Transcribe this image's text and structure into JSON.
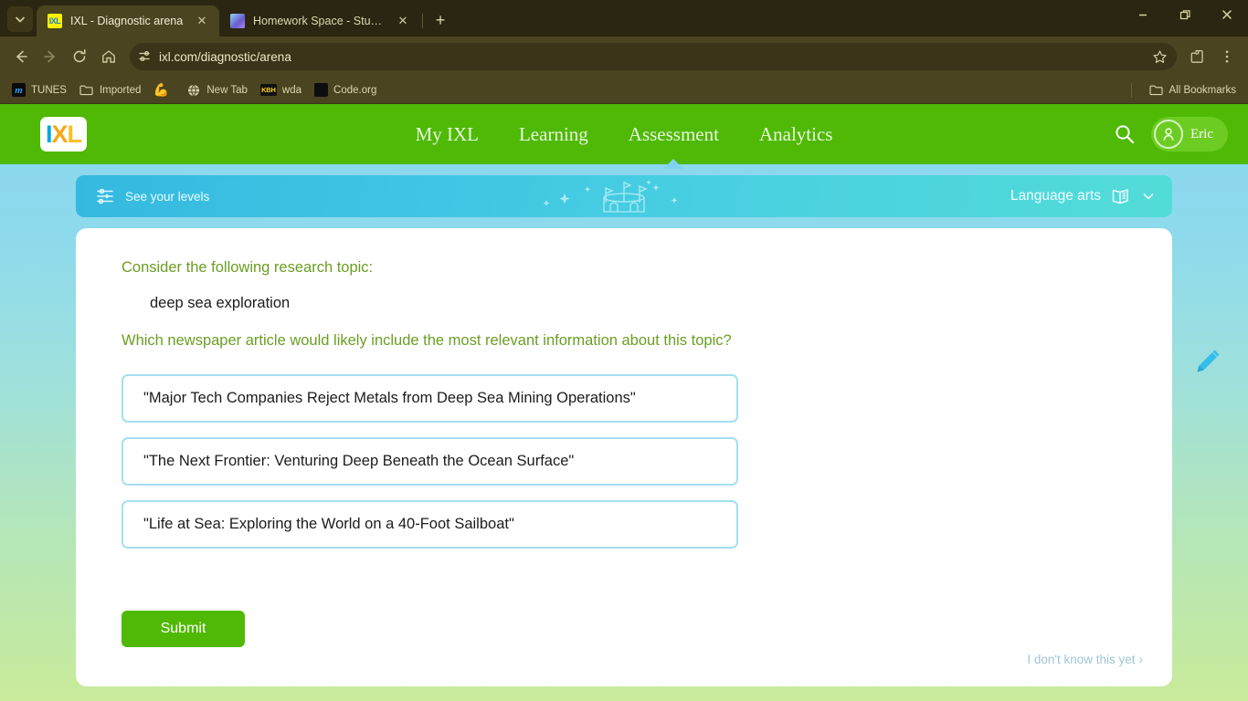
{
  "browser": {
    "tabs": [
      {
        "title": "IXL - Diagnostic arena",
        "favicon": "ixl-favicon",
        "active": true,
        "close_label": "✕"
      },
      {
        "title": "Homework Space - StudyX",
        "favicon": "studyx-favicon",
        "active": false,
        "close_label": "✕"
      }
    ],
    "new_tab_label": "+",
    "tab_list_icon": "chevron-down-icon",
    "window_controls": {
      "minimize": "—",
      "maximize": "❐",
      "close": "✕"
    },
    "toolbar": {
      "back_icon": "back-arrow-icon",
      "forward_icon": "forward-arrow-icon",
      "reload_icon": "reload-icon",
      "home_icon": "home-icon",
      "site_info_icon": "page-settings-icon",
      "url": "ixl.com/diagnostic/arena",
      "bookmark_star_icon": "star-icon",
      "extensions_icon": "extensions-puzzle-icon",
      "menu_icon": "three-dot-menu-icon"
    },
    "bookmarks": [
      {
        "label": "TUNES",
        "icon": "m-favicon"
      },
      {
        "label": "Imported",
        "icon": "folder-icon"
      },
      {
        "label": "",
        "icon": "flexed-biceps-emoji"
      },
      {
        "label": "New Tab",
        "icon": "globe-icon"
      },
      {
        "label": "wda",
        "icon": "kbh-favicon"
      },
      {
        "label": "Code.org",
        "icon": "code-grid-icon"
      }
    ],
    "all_bookmarks_label": "All Bookmarks"
  },
  "site": {
    "logo": {
      "i": "I",
      "x": "X",
      "l": "L"
    },
    "nav": [
      {
        "label": "My IXL",
        "active": false
      },
      {
        "label": "Learning",
        "active": false
      },
      {
        "label": "Assessment",
        "active": true
      },
      {
        "label": "Analytics",
        "active": false
      }
    ],
    "search_icon": "search-icon",
    "user": {
      "name": "Eric",
      "avatar_icon": "user-avatar-icon"
    }
  },
  "levels_banner": {
    "icon": "levels-sliders-icon",
    "label": "See your levels",
    "decoration_icon": "arena-castle-icon",
    "subject": "Language arts",
    "subject_icon": "open-book-icon",
    "chevron_icon": "chevron-down-icon"
  },
  "question": {
    "prompt": "Consider the following research topic:",
    "topic": "deep sea exploration",
    "question": "Which newspaper article would likely include the most relevant information about this topic?",
    "options": [
      "\"Major Tech Companies Reject Metals from Deep Sea Mining Operations\"",
      "\"The Next Frontier: Venturing Deep Beneath the Ocean Surface\"",
      "\"Life at Sea: Exploring the World on a 40-Foot Sailboat\""
    ],
    "submit_label": "Submit",
    "skip_label": "I don't know this yet",
    "skip_chevron": "›",
    "scratchpad_icon": "pencil-icon"
  },
  "colors": {
    "ixl_green": "#4fb905",
    "banner_blue": "#3fc4e4",
    "prompt_green": "#6a9e23",
    "option_border": "#a5dff2",
    "chrome_dark": "#2b2611"
  }
}
